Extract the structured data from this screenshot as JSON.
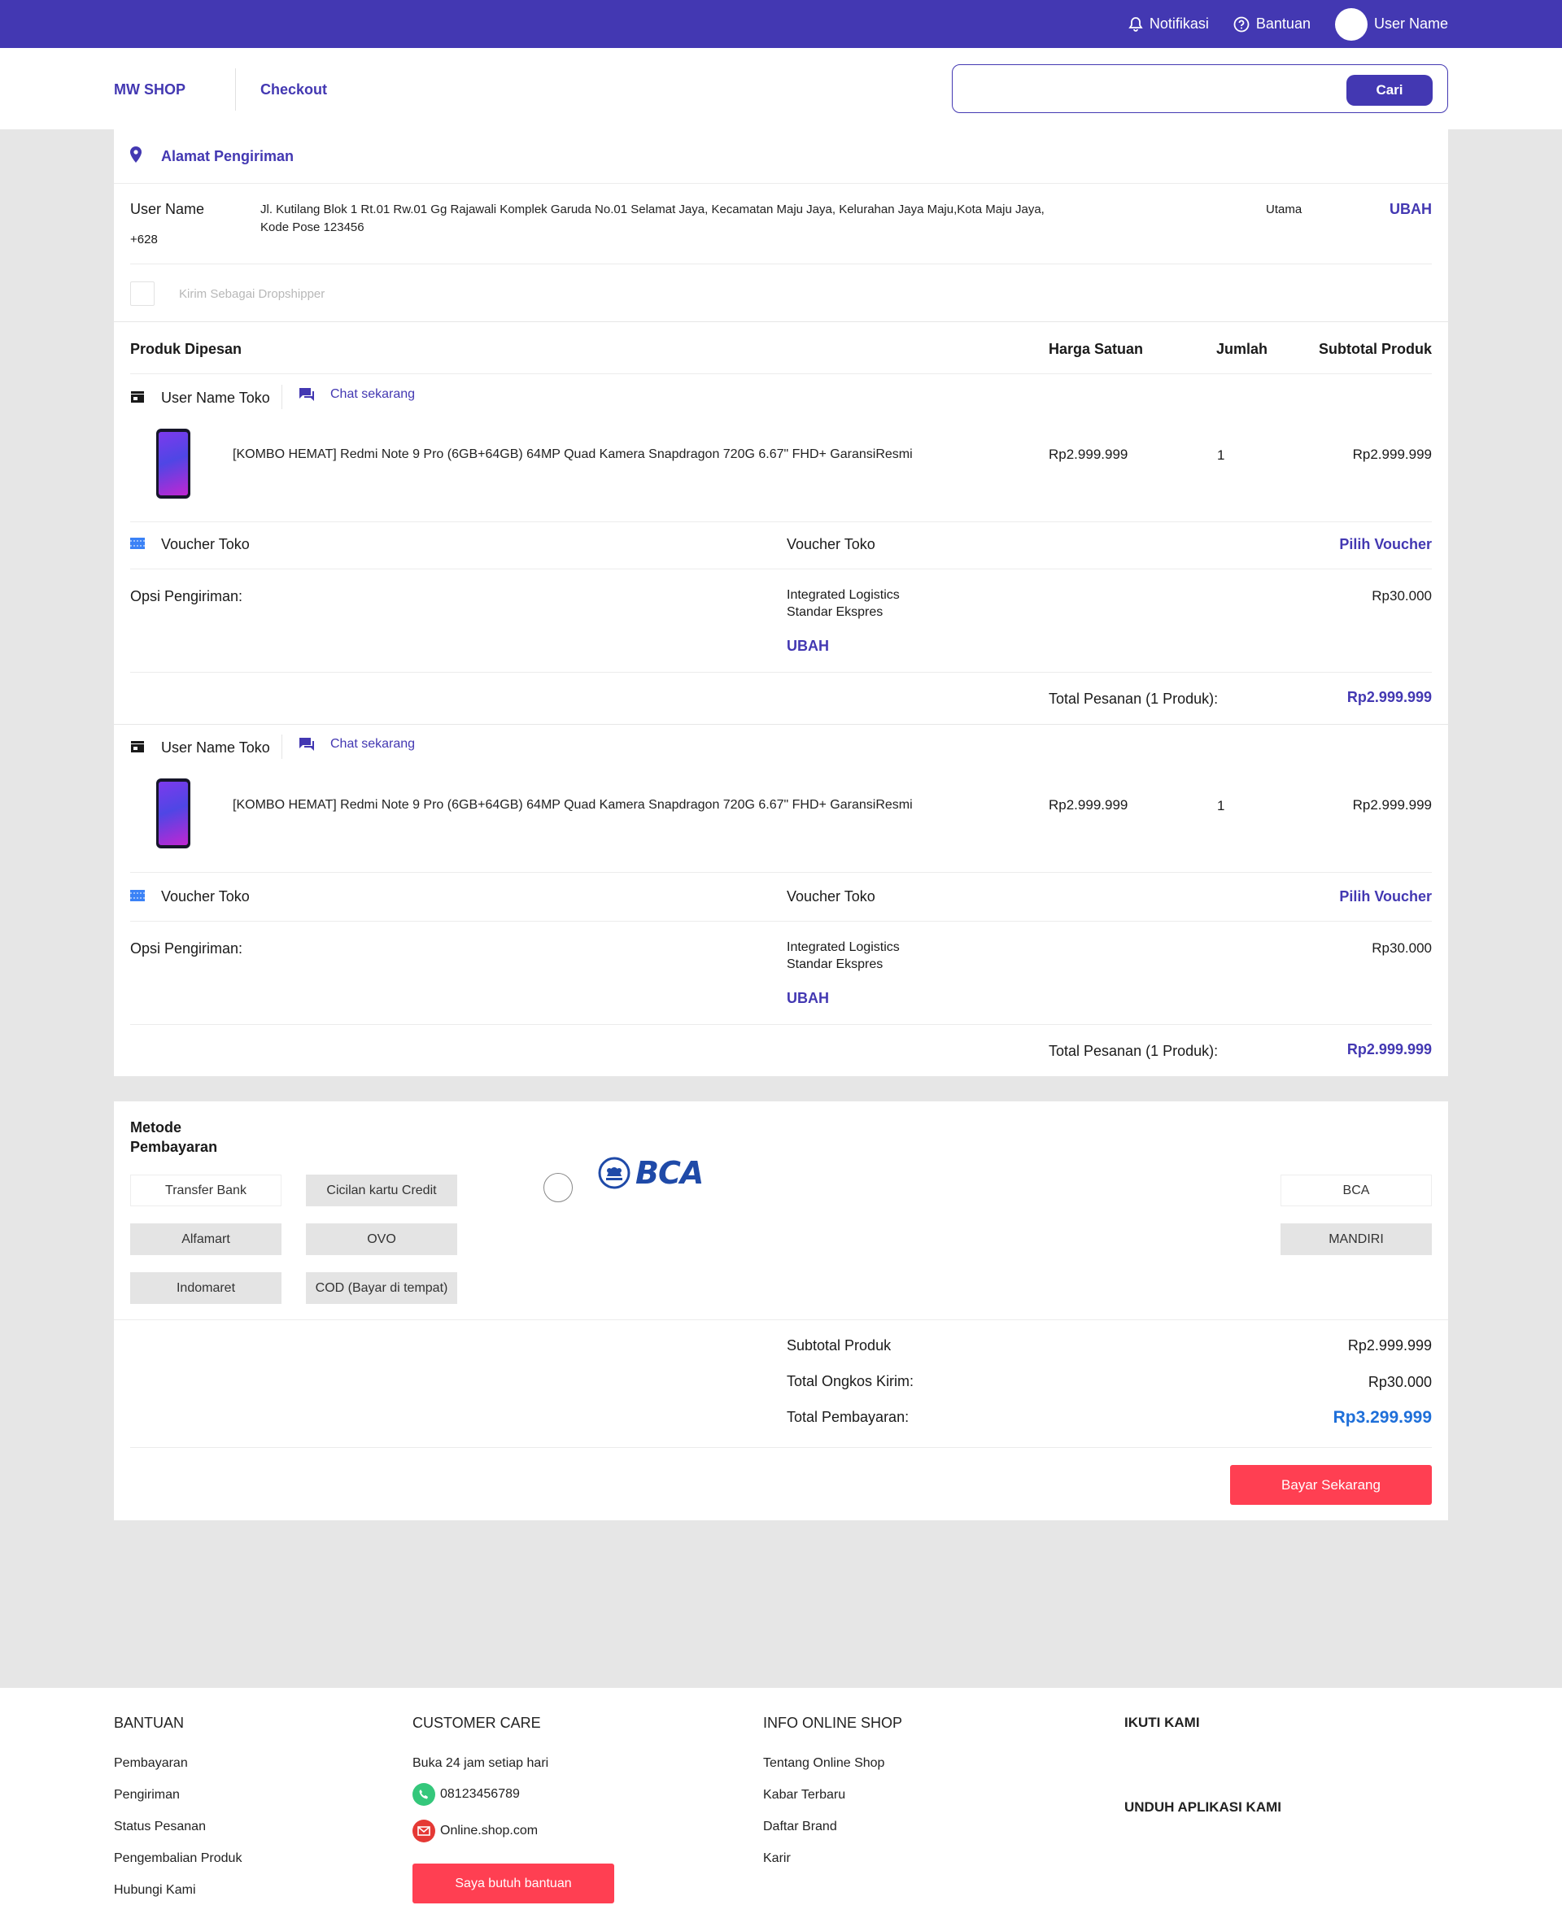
{
  "topbar": {
    "notifications": "Notifikasi",
    "help": "Bantuan",
    "username": "User Name"
  },
  "header": {
    "brand": "MW SHOP",
    "title": "Checkout",
    "search": {
      "placeholder": "",
      "button": "Cari"
    }
  },
  "address": {
    "section_title": "Alamat Pengiriman",
    "name": "User Name",
    "phone": "+628",
    "line1": "Jl. Kutilang Blok 1 Rt.01 Rw.01 Gg Rajawali Komplek Garuda No.01 Selamat Jaya, Kecamatan Maju Jaya, Kelurahan Jaya Maju,Kota Maju Jaya,",
    "line2": "Kode Pose 123456",
    "badge": "Utama",
    "change": "UBAH",
    "dropshipper": "Kirim Sebagai Dropshipper"
  },
  "products_header": {
    "title": "Produk Dipesan",
    "unit_price": "Harga Satuan",
    "qty": "Jumlah",
    "subtotal": "Subtotal Produk"
  },
  "orders": [
    {
      "store": "User Name Toko",
      "chat": "Chat sekarang",
      "product": "[KOMBO HEMAT] Redmi Note 9 Pro (6GB+64GB)  64MP Quad Kamera Snapdragon 720G 6.67\" FHD+ GaransiResmi",
      "price": "Rp2.999.999",
      "qty": "1",
      "subtotal": "Rp2.999.999",
      "voucher_label": "Voucher Toko",
      "voucher_mid": "Voucher Toko",
      "voucher_action": "Pilih Voucher",
      "shipping_label": "Opsi Pengiriman:",
      "courier": "Integrated Logistics",
      "service": "Standar Ekspres",
      "shipping_change": "UBAH",
      "shipping_cost": "Rp30.000",
      "total_label": "Total Pesanan (1 Produk):",
      "total": "Rp2.999.999"
    },
    {
      "store": "User Name Toko",
      "chat": "Chat sekarang",
      "product": "[KOMBO HEMAT] Redmi Note 9 Pro (6GB+64GB)  64MP Quad Kamera Snapdragon 720G 6.67\" FHD+ GaransiResmi",
      "price": "Rp2.999.999",
      "qty": "1",
      "subtotal": "Rp2.999.999",
      "voucher_label": "Voucher Toko",
      "voucher_mid": "Voucher Toko",
      "voucher_action": "Pilih Voucher",
      "shipping_label": "Opsi Pengiriman:",
      "courier": "Integrated Logistics",
      "service": "Standar Ekspres",
      "shipping_change": "UBAH",
      "shipping_cost": "Rp30.000",
      "total_label": "Total Pesanan (1 Produk):",
      "total": "Rp2.999.999"
    }
  ],
  "payment": {
    "title_line1": "Metode",
    "title_line2": "Pembayaran",
    "methods": [
      "Transfer Bank",
      "Cicilan kartu Credit",
      "Alfamart",
      "OVO",
      "Indomaret",
      "COD (Bayar di tempat)"
    ],
    "bank_logo_text": "BCA",
    "banks": [
      "BCA",
      "MANDIRI"
    ],
    "subtotal_label": "Subtotal Produk",
    "subtotal": "Rp2.999.999",
    "shipping_label": "Total Ongkos Kirim:",
    "shipping": "Rp30.000",
    "total_label": "Total Pembayaran:",
    "total": "Rp3.299.999",
    "pay_button": "Bayar Sekarang"
  },
  "footer": {
    "help": {
      "title": "BANTUAN",
      "links": [
        "Pembayaran",
        "Pengiriman",
        "Status Pesanan",
        "Pengembalian Produk",
        "Hubungi Kami"
      ]
    },
    "care": {
      "title": "CUSTOMER CARE",
      "hours": "Buka 24 jam setiap hari",
      "phone": "08123456789",
      "email": "Online.shop.com",
      "button": "Saya butuh bantuan"
    },
    "info": {
      "title": "INFO ONLINE SHOP",
      "links": [
        "Tentang Online Shop",
        "Kabar Terbaru",
        "Daftar Brand",
        "Karir"
      ]
    },
    "follow": {
      "title": "IKUTI KAMI"
    },
    "app": {
      "title": "UNDUH APLIKASI KAMI"
    }
  },
  "colors": {
    "brand": "#4338b2",
    "accent_red": "#ff3f52",
    "total_blue": "#1e6fd9",
    "background": "#e6e6e6"
  }
}
